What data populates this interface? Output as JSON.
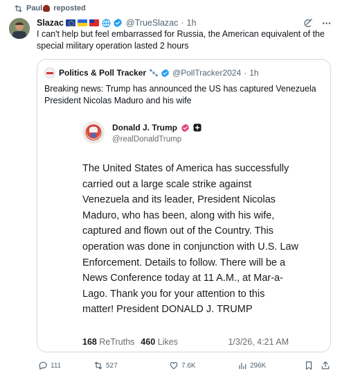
{
  "repost": {
    "label": "Paul",
    "suffix": "reposted"
  },
  "tweet": {
    "author_name": "Slazac",
    "handle": "@TrueSlazac",
    "time": "1h",
    "text": "I can't help but feel embarrassed for Russia, the American equivalent of the special military operation lasted 2 hours"
  },
  "quote": {
    "author_name": "Politics & Poll Tracker",
    "handle": "@PollTracker2024",
    "time": "1h",
    "text": "Breaking news: Trump has announced the US has captured Venezuela President Nicolas Maduro and his wife"
  },
  "truth": {
    "author_name": "Donald J. Trump",
    "handle": "@realDonaldTrump",
    "body": "The United States of America has successfully carried out a large scale strike against Venezuela and its leader, President Nicolas Maduro, who has been, along with his wife, captured and flown out of the Country. This operation was done in conjunction with U.S. Law Enforcement. Details to follow. There will be a News Conference today at 11 A.M., at Mar-a-Lago. Thank you for your attention to this matter! President DONALD J. TRUMP",
    "retruths_count": "168",
    "retruths_label": "ReTruths",
    "likes_count": "460",
    "likes_label": "Likes",
    "date": "1/3/26, 4:21 AM"
  },
  "actions": {
    "replies": "111",
    "reposts": "527",
    "likes": "7.6K",
    "views": "296K"
  },
  "colors": {
    "accent": "#1d9bf0",
    "muted": "#536471",
    "border": "#cfd9de",
    "truth_badge": "#e0407a"
  }
}
